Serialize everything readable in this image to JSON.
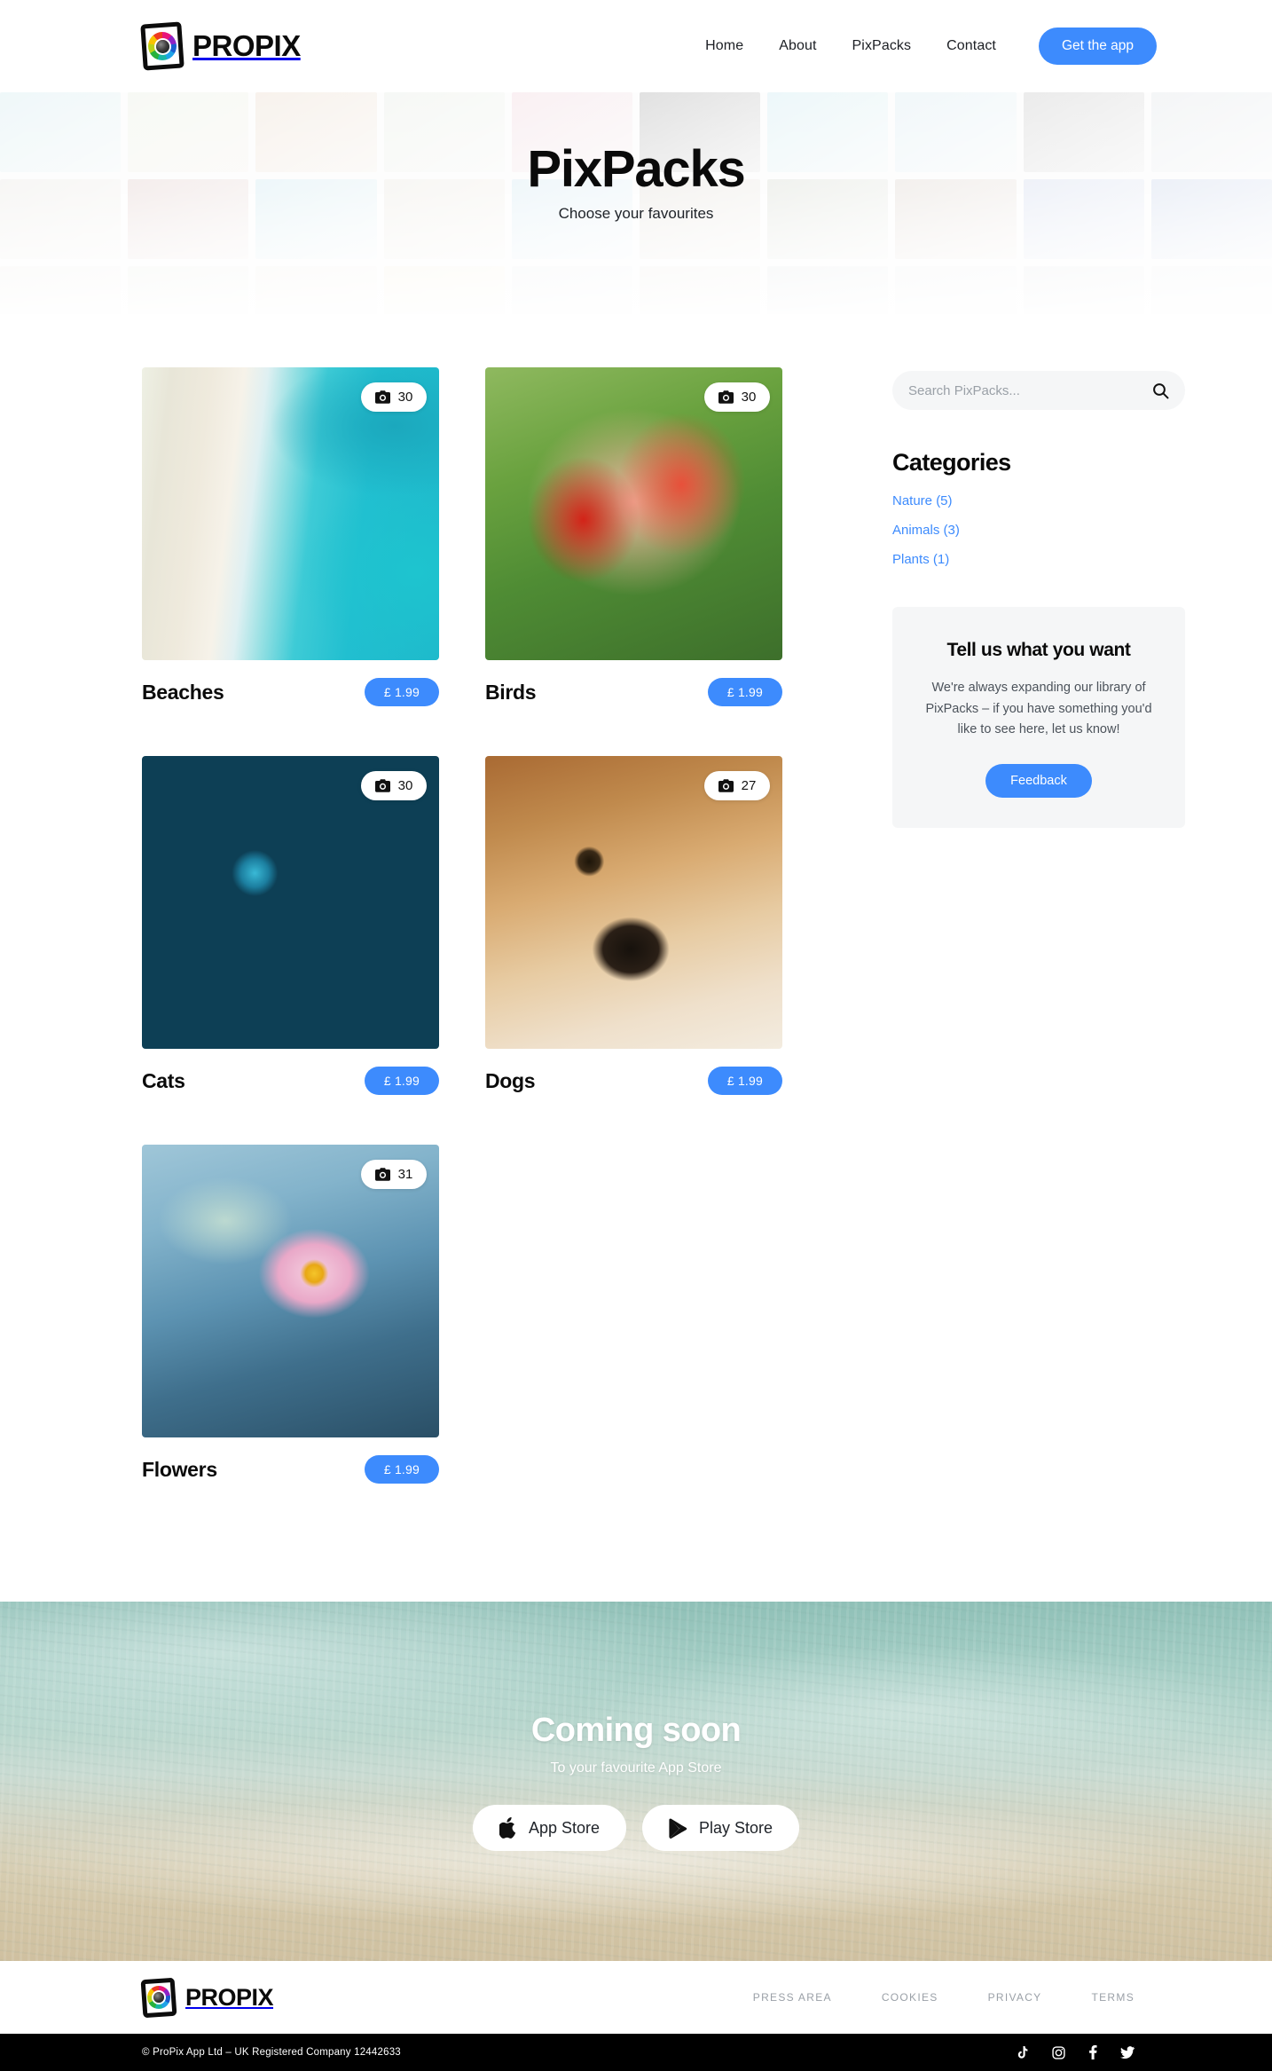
{
  "brand": {
    "name": "PROPIX",
    "logo_icon": "aperture-camera-icon"
  },
  "header": {
    "nav": [
      {
        "label": "Home"
      },
      {
        "label": "About"
      },
      {
        "label": "PixPacks"
      },
      {
        "label": "Contact"
      }
    ],
    "cta_label": "Get the app"
  },
  "hero": {
    "title": "PixPacks",
    "subtitle": "Choose your favourites"
  },
  "packs": [
    {
      "title": "Beaches",
      "count": "30",
      "price": "£ 1.99",
      "photo": "beach-aerial",
      "count_icon": "camera-icon"
    },
    {
      "title": "Birds",
      "count": "30",
      "price": "£ 1.99",
      "photo": "cardinals-fighting",
      "count_icon": "camera-icon"
    },
    {
      "title": "Cats",
      "count": "30",
      "price": "£ 1.99",
      "photo": "grey-tabby-blue-eyes",
      "count_icon": "camera-icon"
    },
    {
      "title": "Dogs",
      "count": "27",
      "price": "£ 1.99",
      "photo": "beagle-resting",
      "count_icon": "camera-icon"
    },
    {
      "title": "Flowers",
      "count": "31",
      "price": "£ 1.99",
      "photo": "pink-water-lily",
      "count_icon": "camera-icon"
    }
  ],
  "sidebar": {
    "search": {
      "placeholder": "Search PixPacks...",
      "value": "",
      "icon": "search-icon"
    },
    "categories_title": "Categories",
    "categories": [
      {
        "label": "Nature (5)"
      },
      {
        "label": "Animals (3)"
      },
      {
        "label": "Plants (1)"
      }
    ],
    "tell_us": {
      "title": "Tell us what you want",
      "body": "We're always expanding our library of PixPacks – if you have something you'd like to see here, let us know!",
      "button_label": "Feedback"
    }
  },
  "coming_soon": {
    "title": "Coming soon",
    "subtitle": "To your favourite App Store",
    "buttons": [
      {
        "label": "App Store",
        "icon": "apple-icon"
      },
      {
        "label": "Play Store",
        "icon": "google-play-icon"
      }
    ]
  },
  "footer": {
    "links": [
      {
        "label": "PRESS AREA"
      },
      {
        "label": "COOKIES"
      },
      {
        "label": "PRIVACY"
      },
      {
        "label": "TERMS"
      }
    ],
    "copyright": "© ProPix App Ltd – UK Registered Company 12442633",
    "socials": [
      {
        "name": "tiktok-icon"
      },
      {
        "name": "instagram-icon"
      },
      {
        "name": "facebook-icon"
      },
      {
        "name": "twitter-icon"
      }
    ]
  },
  "colors": {
    "accent": "#3d8bfd",
    "text": "#111418",
    "muted": "#9aa0a7",
    "panel": "#f5f6f7"
  }
}
